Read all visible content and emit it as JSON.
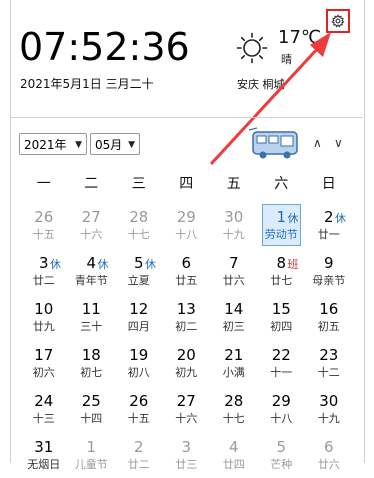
{
  "clock": {
    "time": "07:52:36",
    "date": "2021年5月1日  三月二十"
  },
  "weather": {
    "temp": "17℃",
    "condition": "晴",
    "city": "安庆 桐城",
    "icon": "sun-icon"
  },
  "controls": {
    "year": "2021年",
    "month": "05月",
    "prev": "∧",
    "next": "∨"
  },
  "weekdays": [
    "一",
    "二",
    "三",
    "四",
    "五",
    "六",
    "日"
  ],
  "colors": {
    "rest": "#1e6fb8",
    "work": "#d03030",
    "highlight": "#dcebfb",
    "settings_border": "#e02424"
  },
  "days": [
    {
      "n": "26",
      "s": "十五",
      "dim": true
    },
    {
      "n": "27",
      "s": "十六",
      "dim": true
    },
    {
      "n": "28",
      "s": "十七",
      "dim": true
    },
    {
      "n": "29",
      "s": "十八",
      "dim": true
    },
    {
      "n": "30",
      "s": "十九",
      "dim": true
    },
    {
      "n": "1",
      "s": "劳动节",
      "today": true,
      "b": "休",
      "bt": "rest"
    },
    {
      "n": "2",
      "s": "廿一",
      "b": "休",
      "bt": "rest"
    },
    {
      "n": "3",
      "s": "廿二",
      "b": "休",
      "bt": "rest"
    },
    {
      "n": "4",
      "s": "青年节",
      "b": "休",
      "bt": "rest"
    },
    {
      "n": "5",
      "s": "立夏",
      "b": "休",
      "bt": "rest"
    },
    {
      "n": "6",
      "s": "廿五"
    },
    {
      "n": "7",
      "s": "廿六"
    },
    {
      "n": "8",
      "s": "廿七",
      "b": "班",
      "bt": "work"
    },
    {
      "n": "9",
      "s": "母亲节"
    },
    {
      "n": "10",
      "s": "廿九"
    },
    {
      "n": "11",
      "s": "三十"
    },
    {
      "n": "12",
      "s": "四月"
    },
    {
      "n": "13",
      "s": "初二"
    },
    {
      "n": "14",
      "s": "初三"
    },
    {
      "n": "15",
      "s": "初四"
    },
    {
      "n": "16",
      "s": "初五"
    },
    {
      "n": "17",
      "s": "初六"
    },
    {
      "n": "18",
      "s": "初七"
    },
    {
      "n": "19",
      "s": "初八"
    },
    {
      "n": "20",
      "s": "初九"
    },
    {
      "n": "21",
      "s": "小满"
    },
    {
      "n": "22",
      "s": "十一"
    },
    {
      "n": "23",
      "s": "十二"
    },
    {
      "n": "24",
      "s": "十三"
    },
    {
      "n": "25",
      "s": "十四"
    },
    {
      "n": "26",
      "s": "十五"
    },
    {
      "n": "27",
      "s": "十六"
    },
    {
      "n": "28",
      "s": "十七"
    },
    {
      "n": "29",
      "s": "十八"
    },
    {
      "n": "30",
      "s": "十九"
    },
    {
      "n": "31",
      "s": "无烟日"
    },
    {
      "n": "1",
      "s": "儿童节",
      "dim": true
    },
    {
      "n": "2",
      "s": "廿二",
      "dim": true
    },
    {
      "n": "3",
      "s": "廿三",
      "dim": true
    },
    {
      "n": "4",
      "s": "廿四",
      "dim": true
    },
    {
      "n": "5",
      "s": "芒种",
      "dim": true
    },
    {
      "n": "6",
      "s": "廿六",
      "dim": true
    }
  ]
}
